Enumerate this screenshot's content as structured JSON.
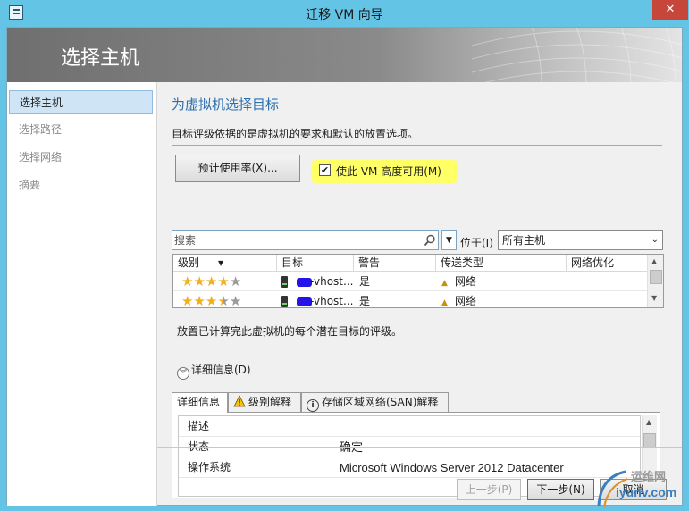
{
  "window": {
    "title": "迁移 VM 向导",
    "close_glyph": "✕"
  },
  "banner": {
    "title": "选择主机"
  },
  "nav": {
    "items": [
      "选择主机",
      "选择路径",
      "选择网络",
      "摘要"
    ],
    "selected_index": 0
  },
  "content": {
    "heading": "为虚拟机选择目标",
    "description": "目标评级依据的是虚拟机的要求和默认的放置选项。",
    "usage_button": "预计使用率(X)...",
    "ha_checkbox": {
      "label": "使此 VM 高度可用(M)",
      "checked": true,
      "check_glyph": "✔"
    },
    "search": {
      "placeholder": "搜索",
      "dropdown_glyph": "▼"
    },
    "location": {
      "label": "位于(I)",
      "value": "所有主机",
      "chevron": "⌄"
    },
    "grid": {
      "columns": [
        "级别",
        "目标",
        "警告",
        "传送类型",
        "网络优化"
      ],
      "rows": [
        {
          "rating": 4,
          "target": "-vhost...",
          "warning": "是",
          "transfer": "网络",
          "network_opt": ""
        },
        {
          "rating": 3.5,
          "target": "-vhost...",
          "warning": "是",
          "transfer": "网络",
          "network_opt": ""
        }
      ],
      "star_glyph": "★"
    },
    "placement_note": "放置已计算完此虚拟机的每个潜在目标的评级。",
    "details_toggle": "详细信息(D)",
    "tabs": [
      "详细信息",
      "级别解释",
      "存储区域网络(SAN)解释"
    ],
    "properties": [
      {
        "key": "描述",
        "value": ""
      },
      {
        "key": "状态",
        "value": "确定"
      },
      {
        "key": "操作系统",
        "value": "Microsoft Windows Server 2012 Datacenter"
      }
    ]
  },
  "footer": {
    "prev": "上一步(P)",
    "next": "下一步(N)",
    "cancel": "取消"
  },
  "watermark": {
    "line1": "运维网",
    "line2": "iyunv.com"
  },
  "colors": {
    "accent": "#2a6fb0",
    "highlight": "#ffff66",
    "title_bar": "#64c4e6",
    "star": "#f2b01e",
    "redaction": "#2414e8"
  }
}
